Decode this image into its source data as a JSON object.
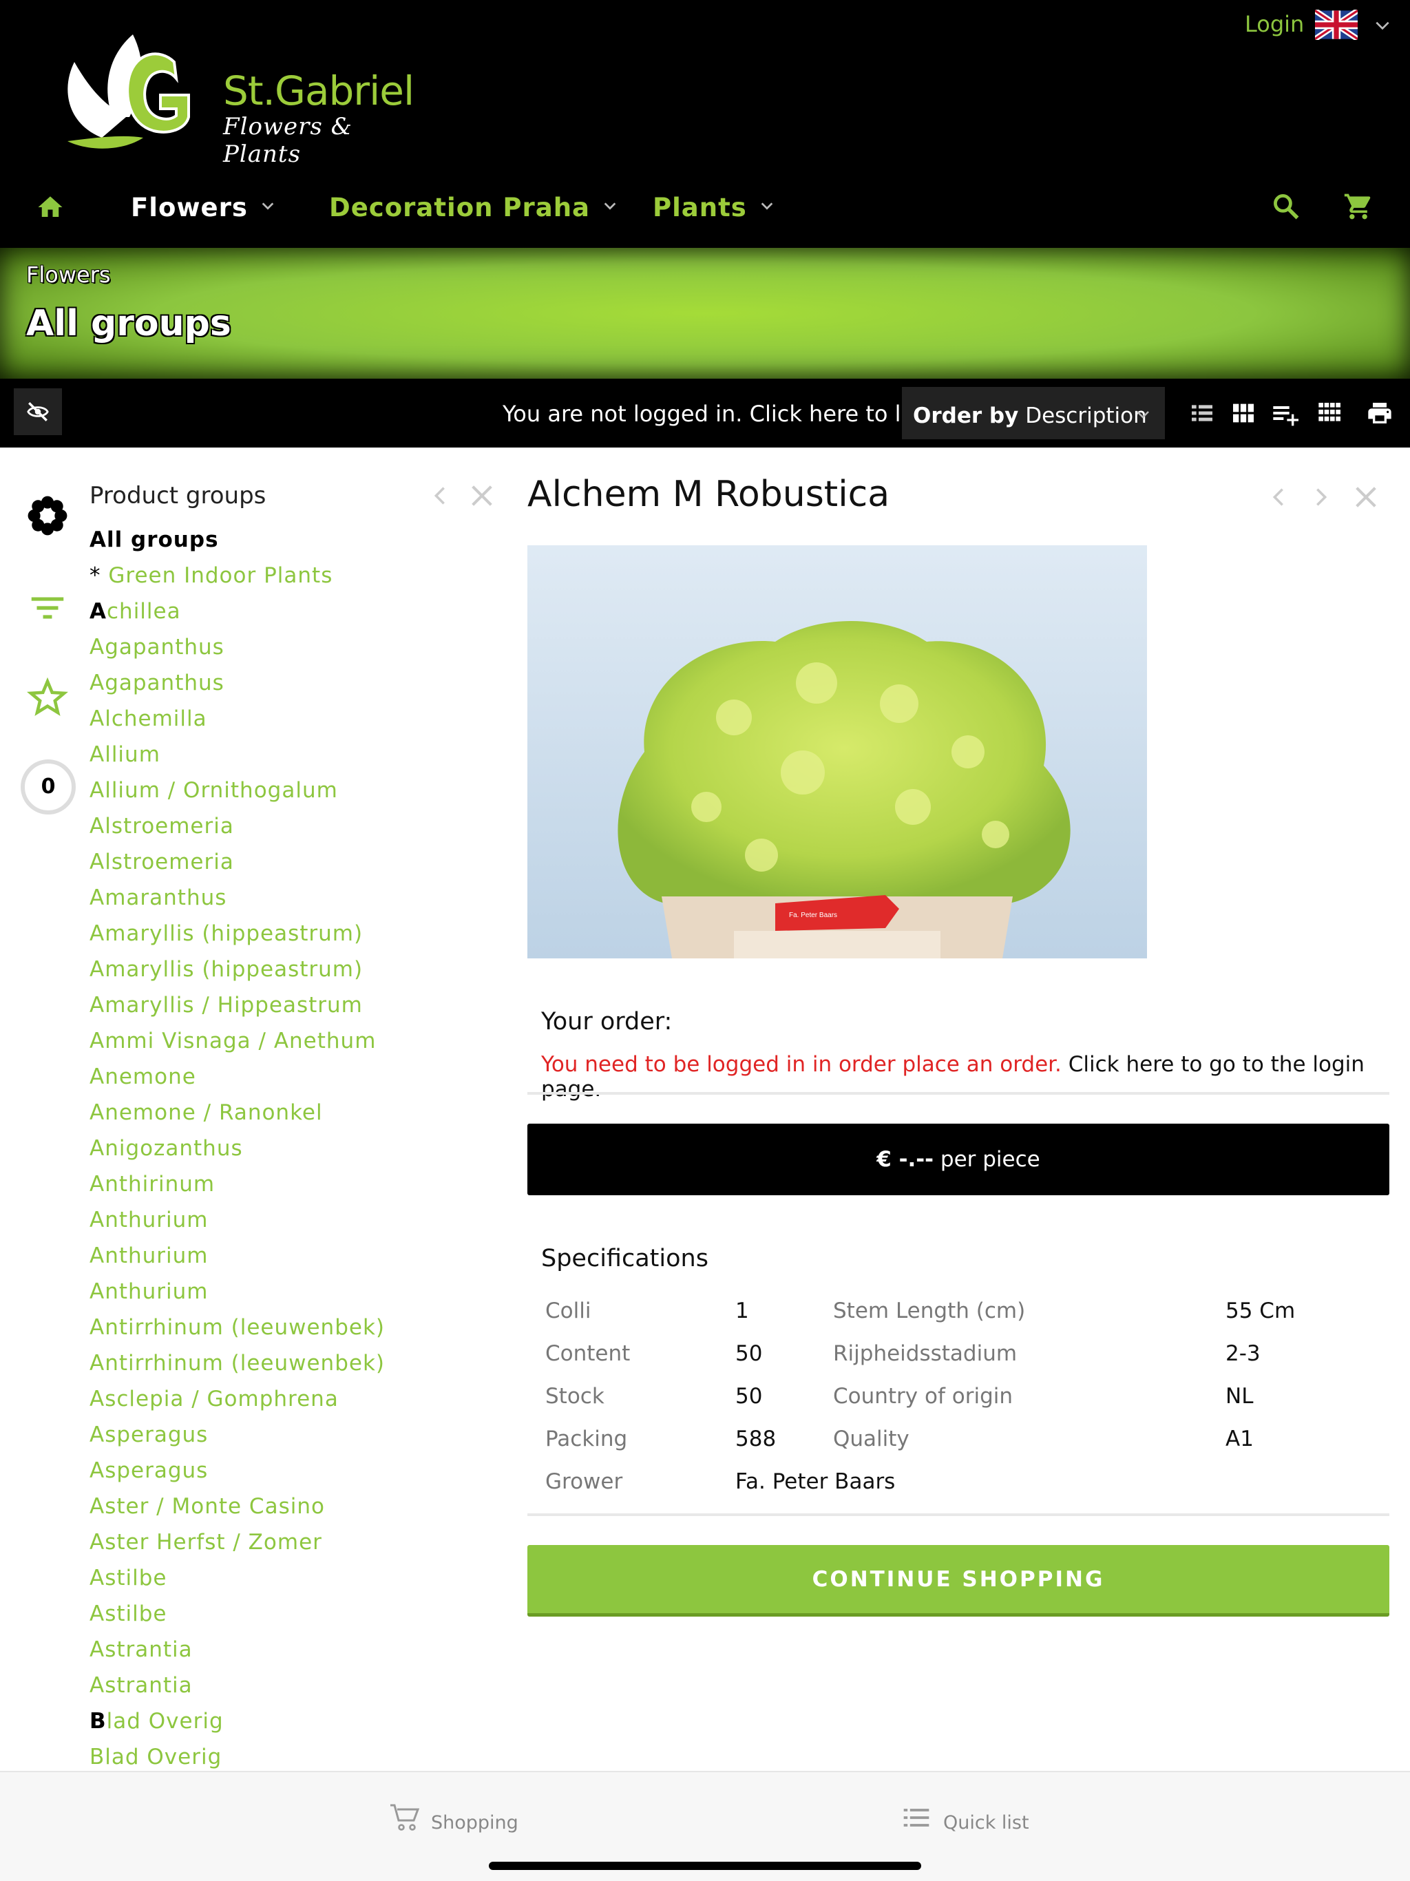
{
  "header": {
    "logo": {
      "initial": "G",
      "name": "St.Gabriel",
      "tagline": "Flowers & Plants"
    },
    "login_label": "Login",
    "language_icon": "uk-flag-icon",
    "nav": {
      "home_icon": "home-icon",
      "items": [
        {
          "label": "Flowers"
        },
        {
          "label": "Decoration Praha"
        },
        {
          "label": "Plants"
        }
      ],
      "search_icon": "search-icon",
      "cart_icon": "cart-icon"
    }
  },
  "banner": {
    "subtitle": "Flowers",
    "title": "All groups"
  },
  "toolbar": {
    "login_message": "You are not logged in. Click here to log in.",
    "order_by_label": "Order by",
    "order_by_value": "Description"
  },
  "sidebar": {
    "icons": [
      "flower-icon",
      "filter-icon",
      "star-icon"
    ],
    "cart_count": "0"
  },
  "product_groups": {
    "title": "Product groups",
    "items": [
      "All groups",
      "* Green Indoor Plants",
      "Achillea",
      "Agapanthus",
      "Agapanthus",
      "Alchemilla",
      "Allium",
      "Allium / Ornithogalum",
      "Alstroemeria",
      "Alstroemeria",
      "Amaranthus",
      "Amaryllis (hippeastrum)",
      "Amaryllis (hippeastrum)",
      "Amaryllis / Hippeastrum",
      "Ammi Visnaga / Anethum",
      "Anemone",
      "Anemone / Ranonkel",
      "Anigozanthus",
      "Anthirinum",
      "Anthurium",
      "Anthurium",
      "Anthurium",
      "Antirrhinum (leeuwenbek)",
      "Antirrhinum (leeuwenbek)",
      "Asclepia / Gomphrena",
      "Asperagus",
      "Asperagus",
      "Aster / Monte Casino",
      "Aster Herfst / Zomer",
      "Astilbe",
      "Astilbe",
      "Astrantia",
      "Astrantia",
      "Blad Overig",
      "Blad Overig"
    ]
  },
  "product": {
    "title": "Alchem M Robustica",
    "image_label": "Fa. Peter Baars",
    "order_title": "Your order:",
    "order_warning": "You need to be logged in in order place an order.",
    "order_login_link": " Click here to go to the login page.",
    "price": "€ -.--",
    "price_unit": " per piece",
    "specs_title": "Specifications",
    "specs": {
      "colli_k": "Colli",
      "colli_v": "1",
      "content_k": "Content",
      "content_v": "50",
      "stock_k": "Stock",
      "stock_v": "50",
      "packing_k": "Packing",
      "packing_v": "588",
      "grower_k": "Grower",
      "grower_v": "Fa. Peter Baars",
      "stem_k": "Stem Length (cm)",
      "stem_v": "55 Cm",
      "ripeness_k": "Rijpheidsstadium",
      "ripeness_v": "2-3",
      "country_k": "Country of origin",
      "country_v": "NL",
      "quality_k": "Quality",
      "quality_v": "A1"
    },
    "continue_label": "CONTINUE SHOPPING"
  },
  "tabbar": {
    "shopping_label": "Shopping",
    "quicklist_label": "Quick list"
  },
  "colors": {
    "accent": "#8dc63f",
    "warning": "#e02424",
    "header_bg": "#000000"
  }
}
